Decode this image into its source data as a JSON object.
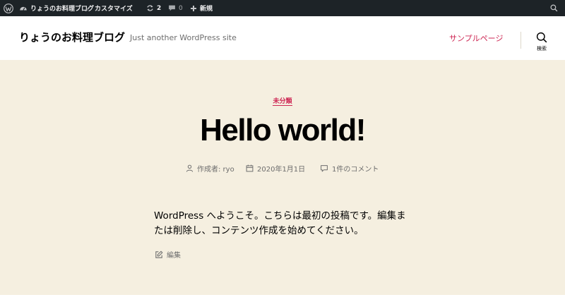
{
  "admin_bar": {
    "wp_logo_icon": "wordpress-icon",
    "site_name": "りょうのお料理ブログ",
    "customize": "カスタマイズ",
    "updates_count": "2",
    "comments_count": "0",
    "new_label": "新規"
  },
  "header": {
    "site_title": "りょうのお料理ブログ",
    "site_description": "Just another WordPress site",
    "nav_item": "サンプルページ",
    "search_label": "検索"
  },
  "post": {
    "category": "未分類",
    "title": "Hello world!",
    "author": "作成者: ryo",
    "date": "2020年1月1日",
    "comments": "1件のコメント",
    "body": "WordPress へようこそ。こちらは最初の投稿です。編集または削除し、コンテンツ作成を始めてください。",
    "edit_label": "編集"
  },
  "colors": {
    "admin_bar_bg": "#1d2327",
    "accent": "#cd2653",
    "content_bg": "#f5efe0",
    "meta_text": "#6d6d6d"
  }
}
